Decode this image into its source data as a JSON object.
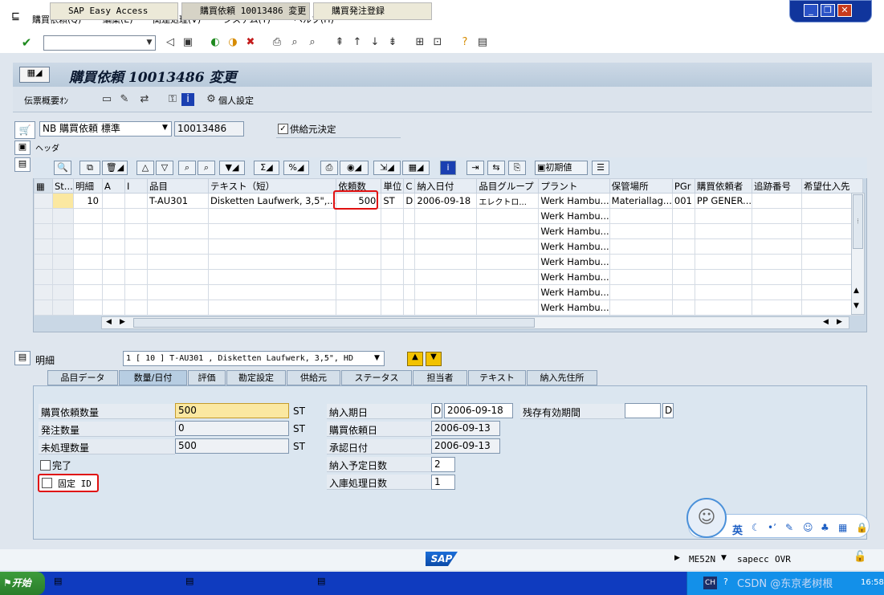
{
  "menu": {
    "items": [
      "購買依頼(Q)",
      "編集(E)",
      "関連処理(V)",
      "システム(Y)",
      "ヘルプ(H)"
    ]
  },
  "title": "購買依頼 10013486 変更",
  "app_toolbar": {
    "doc_overview": "伝票概要ｵﾝ",
    "personal": "個人設定"
  },
  "header": {
    "doc_type": "NB 購買依頼 標準",
    "doc_number": "10013486",
    "source_label": "供給元決定",
    "source_checked": true,
    "header_label": "ヘッダ"
  },
  "grid_toolbar": {
    "default_values": "初期値"
  },
  "grid": {
    "columns": [
      "St...",
      "明細",
      "A",
      "I",
      "品目",
      "テキスト（短）",
      "依頼数",
      "単位",
      "C",
      "納入日付",
      "品目グループ",
      "プラント",
      "保管場所",
      "PGr",
      "購買依頼者",
      "追跡番号",
      "希望仕入先"
    ],
    "row": {
      "item": "10",
      "material": "T-AU301",
      "text": "Disketten Laufwerk, 3,5\",...",
      "qty": "500",
      "unit": "ST",
      "c": "D",
      "date": "2006-09-18",
      "matgroup": "エレクトロ...",
      "plant": "Werk Hambu...",
      "storage": "Materiallag...",
      "pgr": "001",
      "requester": "PP GENER..."
    },
    "plant_fill": "Werk Hambu..."
  },
  "detail": {
    "label": "明細",
    "selection": "1 [ 10 ] T-AU301 , Disketten Laufwerk, 3,5\", HD",
    "tabs": [
      "品目データ",
      "数量/日付",
      "評価",
      "勘定設定",
      "供給元",
      "ステータス",
      "担当者",
      "テキスト",
      "納入先住所"
    ],
    "active_tab": 1,
    "qty_label": "購買依頼数量",
    "qty_value": "500",
    "qty_unit": "ST",
    "ordered_label": "発注数量",
    "ordered_value": "0",
    "ordered_unit": "ST",
    "open_label": "未処理数量",
    "open_value": "500",
    "open_unit": "ST",
    "complete_label": "完了",
    "fixed_label": "固定 ID",
    "delivery_label": "納入期日",
    "delivery_type": "D",
    "delivery_value": "2006-09-18",
    "req_date_label": "購買依頼日",
    "req_date_value": "2006-09-13",
    "approval_label": "承認日付",
    "approval_value": "2006-09-13",
    "planned_label": "納入予定日数",
    "planned_value": "2",
    "gr_label": "入庫処理日数",
    "gr_value": "1",
    "shelf_label": "残存有効期間",
    "shelf_unit": "D"
  },
  "status": {
    "logo": "SAP",
    "transaction": "ME52N",
    "server": "sapecc",
    "mode": "OVR"
  },
  "taskbar": {
    "start": "开始",
    "tasks": [
      "SAP Easy Access",
      "購買依頼 10013486 変更",
      "購買発注登録"
    ],
    "lang": "CH",
    "time": "16:58",
    "watermark": "CSDN @东京老树根"
  },
  "ime": {
    "lang": "英"
  }
}
